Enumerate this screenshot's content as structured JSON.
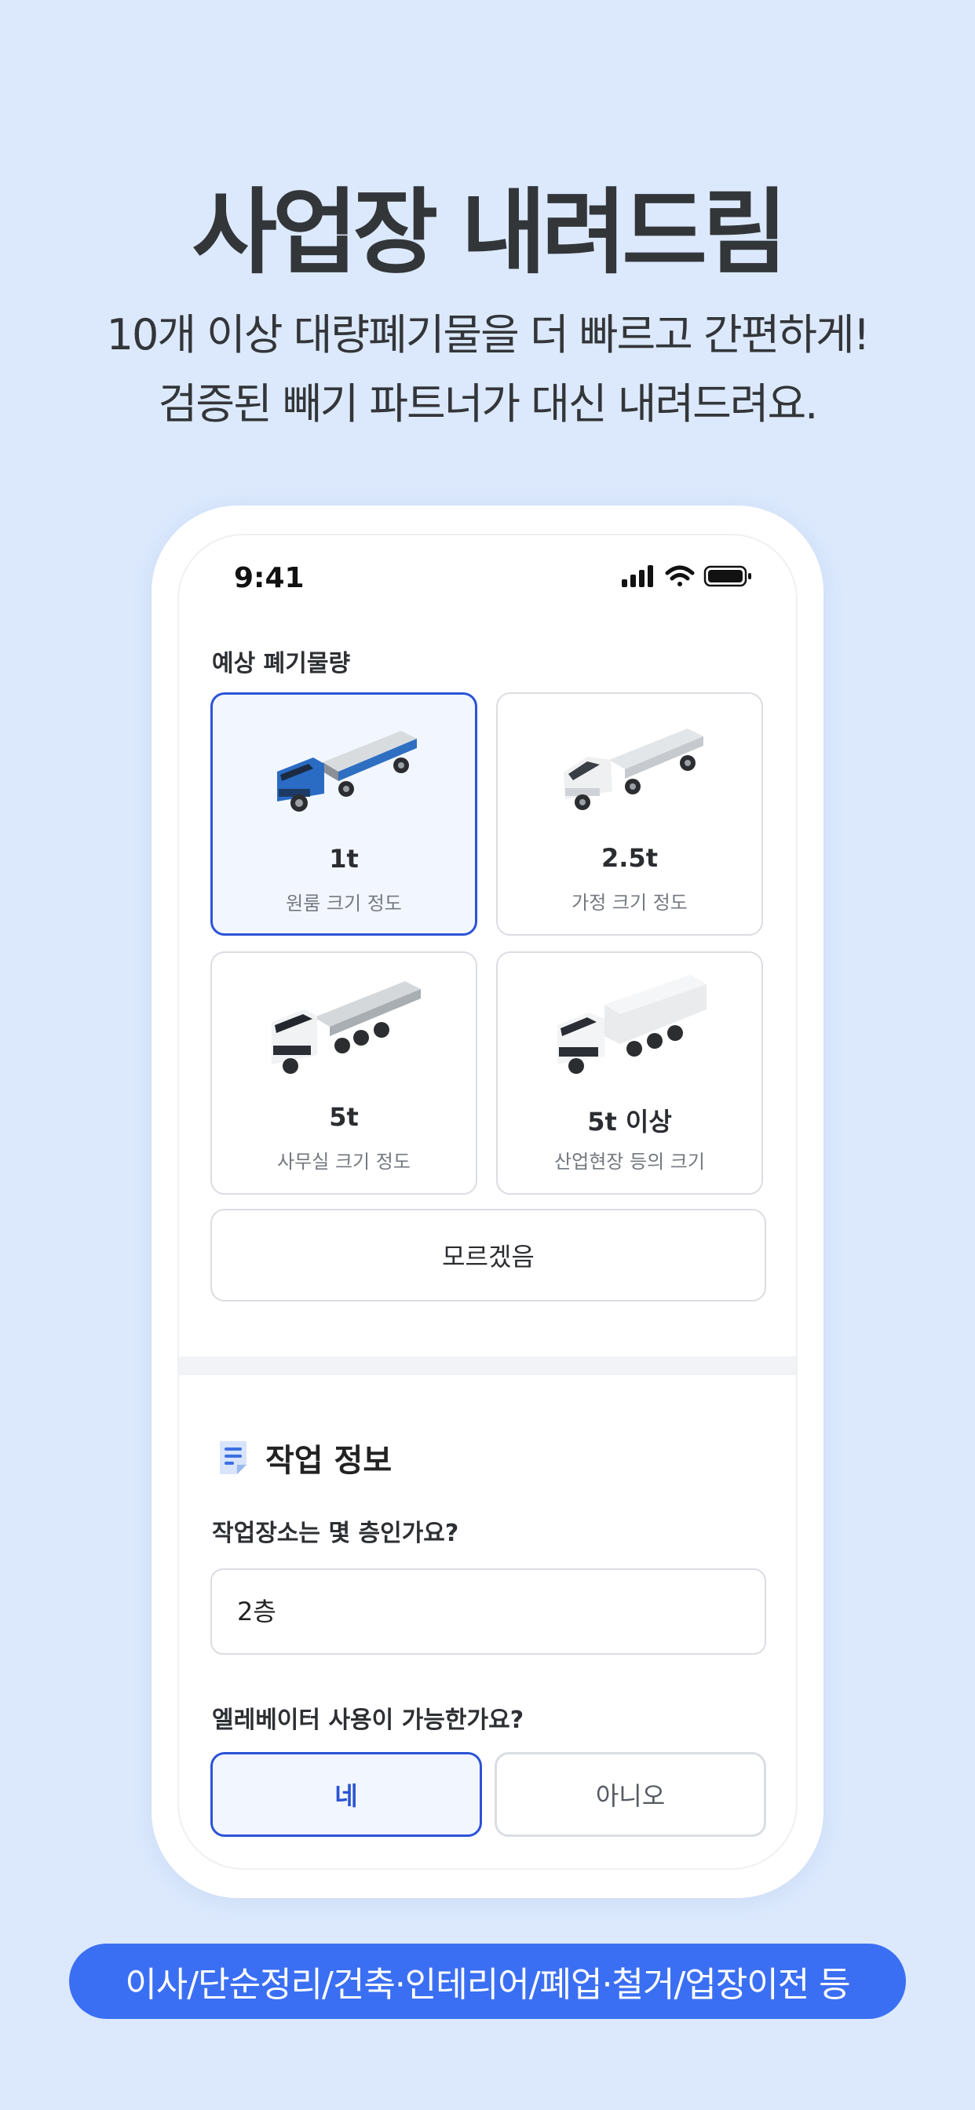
{
  "hero": {
    "title": "사업장 내려드림",
    "subtitle_line1": "10개 이상 대량폐기물을 더 빠르고 간편하게!",
    "subtitle_line2": "검증된 빼기 파트너가 대신 내려드려요."
  },
  "status_bar": {
    "time": "9:41"
  },
  "waste": {
    "label": "예상 폐기물량",
    "options": [
      {
        "title": "1t",
        "subtitle": "원룸 크기 정도",
        "selected": true
      },
      {
        "title": "2.5t",
        "subtitle": "가정 크기 정도",
        "selected": false
      },
      {
        "title": "5t",
        "subtitle": "사무실 크기 정도",
        "selected": false
      },
      {
        "title": "5t 이상",
        "subtitle": "산업현장 등의 크기",
        "selected": false
      }
    ],
    "unknown_label": "모르겠음"
  },
  "work_info": {
    "title": "작업 정보",
    "floor_question": "작업장소는 몇 층인가요?",
    "floor_value": "2층",
    "elevator_question": "엘레베이터 사용이 가능한가요?",
    "yes_label": "네",
    "no_label": "아니오",
    "elevator_selected": "yes"
  },
  "tags": "이사/단순정리/건축·인테리어/폐업·철거/업장이전 등",
  "colors": {
    "accent": "#2c53d6",
    "background": "#dce9fd",
    "pill": "#3b6ff3"
  }
}
